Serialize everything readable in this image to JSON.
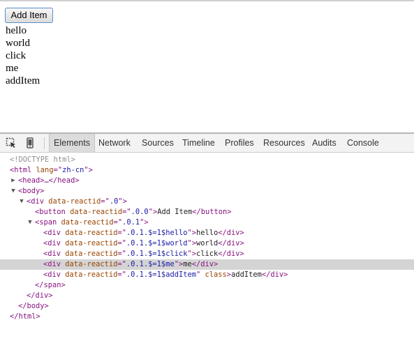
{
  "page": {
    "button_label": "Add Item",
    "items": [
      "hello",
      "world",
      "click",
      "me",
      "addItem"
    ]
  },
  "devtools": {
    "tabs": [
      "Elements",
      "Network",
      "Sources",
      "Timeline",
      "Profiles",
      "Resources",
      "Audits",
      "Console"
    ],
    "active_tab": "Elements",
    "icons": [
      "inspect-element-icon",
      "device-mode-icon"
    ],
    "dom_tree": {
      "doctype": "<!DOCTYPE html>",
      "html_open": "<html",
      "html_attr": "lang",
      "html_attr_eq": "=\"",
      "html_lang": "zh-cn",
      "html_close_quote": "\">",
      "head_collapsed": "<head>…</head>",
      "body_open": "<body>",
      "div_open_tag": "<div",
      "reactid_attr": "data-reactid",
      "div_reactid": ".0",
      "button_open_tag": "<button",
      "button_reactid": ".0.0",
      "button_text": "Add Item",
      "button_close": "</button>",
      "span_open_tag": "<span",
      "span_reactid": ".0.1",
      "children": [
        {
          "reactid": ".0.1.$=1$hello",
          "text": "hello"
        },
        {
          "reactid": ".0.1.$=1$world",
          "text": "world"
        },
        {
          "reactid": ".0.1.$=1$click",
          "text": "click"
        },
        {
          "reactid": ".0.1.$=1$me",
          "text": "me"
        },
        {
          "reactid": ".0.1.$=1$addItem",
          "text": "addItem",
          "extra_attr": "class"
        }
      ],
      "div_close": "</div>",
      "span_close": "</span>",
      "body_close": "</body>",
      "html_close": "</html>"
    }
  }
}
